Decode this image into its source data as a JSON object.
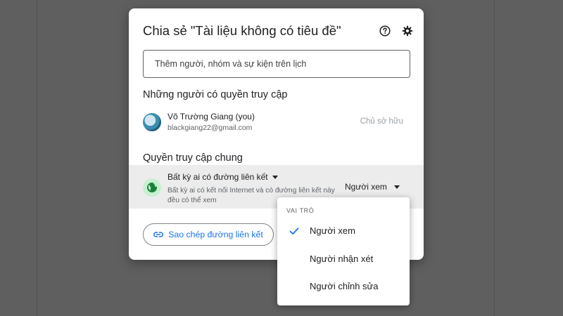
{
  "dialog": {
    "title": "Chia sẻ \"Tài liệu không có tiêu đề\"",
    "help_icon": "help-circle-icon",
    "settings_icon": "gear-icon"
  },
  "add_people": {
    "placeholder": "Thêm người, nhóm và sự kiện trên lịch"
  },
  "people_section": {
    "heading": "Những người có quyền truy cập",
    "people": [
      {
        "name": "Võ Trường Giang (you)",
        "email": "blackgiang22@gmail.com",
        "role": "Chủ sở hữu"
      }
    ]
  },
  "general_access": {
    "heading": "Quyền truy cập chung",
    "link_setting": "Bất kỳ ai có đường liên kết",
    "description": "Bất kỳ ai có kết nối Internet và có đường liên kết này đều có thể xem",
    "role": "Người xem",
    "icon": "globe-icon"
  },
  "actions": {
    "copy_link": "Sao chép đường liên kết",
    "copy_icon": "link-icon"
  },
  "role_menu": {
    "header": "VAI TRÒ",
    "items": [
      {
        "label": "Người xem",
        "selected": true
      },
      {
        "label": "Người nhận xét",
        "selected": false
      },
      {
        "label": "Người chỉnh sửa",
        "selected": false
      }
    ]
  },
  "colors": {
    "backdrop": "#5f5f5f",
    "accent": "#1a73e8",
    "general_row_bg": "#ececec",
    "globe_bg": "#c6f0cf"
  }
}
